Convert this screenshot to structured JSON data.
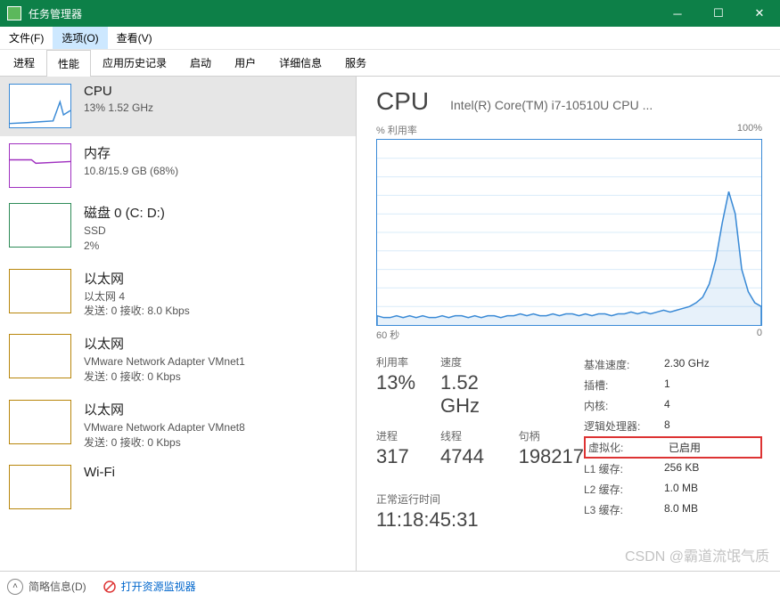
{
  "window": {
    "title": "任务管理器"
  },
  "menu": {
    "file": "文件(F)",
    "options": "选项(O)",
    "view": "查看(V)"
  },
  "tabs": [
    "进程",
    "性能",
    "应用历史记录",
    "启动",
    "用户",
    "详细信息",
    "服务"
  ],
  "active_tab": 1,
  "sidebar": {
    "items": [
      {
        "title": "CPU",
        "line1": "13%  1.52 GHz",
        "color": "blue"
      },
      {
        "title": "内存",
        "line1": "10.8/15.9 GB (68%)",
        "color": "purple"
      },
      {
        "title": "磁盘 0 (C: D:)",
        "line1": "SSD",
        "line2": "2%",
        "color": "green"
      },
      {
        "title": "以太网",
        "line1": "以太网 4",
        "line2": "发送: 0 接收: 8.0 Kbps",
        "color": "brown"
      },
      {
        "title": "以太网",
        "line1": "VMware Network Adapter VMnet1",
        "line2": "发送: 0 接收: 0 Kbps",
        "color": "brown"
      },
      {
        "title": "以太网",
        "line1": "VMware Network Adapter VMnet8",
        "line2": "发送: 0 接收: 0 Kbps",
        "color": "brown"
      },
      {
        "title": "Wi-Fi",
        "line1": "",
        "color": "brown"
      }
    ]
  },
  "detail": {
    "heading": "CPU",
    "model": "Intel(R) Core(TM) i7-10510U CPU ...",
    "chart_top_left": "% 利用率",
    "chart_top_right": "100%",
    "chart_bot_left": "60 秒",
    "chart_bot_right": "0",
    "stats": {
      "util_lbl": "利用率",
      "util_val": "13%",
      "speed_lbl": "速度",
      "speed_val": "1.52 GHz",
      "proc_lbl": "进程",
      "proc_val": "317",
      "thr_lbl": "线程",
      "thr_val": "4744",
      "hnd_lbl": "句柄",
      "hnd_val": "198217",
      "uptime_lbl": "正常运行时间",
      "uptime_val": "11:18:45:31"
    },
    "right": [
      {
        "k": "基准速度:",
        "v": "2.30 GHz"
      },
      {
        "k": "插槽:",
        "v": "1"
      },
      {
        "k": "内核:",
        "v": "4"
      },
      {
        "k": "逻辑处理器:",
        "v": "8"
      },
      {
        "k": "虚拟化:",
        "v": "已启用",
        "boxed": true
      },
      {
        "k": "L1 缓存:",
        "v": "256 KB"
      },
      {
        "k": "L2 缓存:",
        "v": "1.0 MB"
      },
      {
        "k": "L3 缓存:",
        "v": "8.0 MB"
      }
    ]
  },
  "footer": {
    "fewer": "简略信息(D)",
    "resmon": "打开资源监视器"
  },
  "watermark": "CSDN @霸道流氓气质",
  "chart_data": {
    "type": "line",
    "title": "% 利用率",
    "xlabel": "60 秒",
    "ylabel": "% 利用率",
    "ylim": [
      0,
      100
    ],
    "xlim_seconds": [
      60,
      0
    ],
    "series": [
      {
        "name": "CPU 利用率",
        "values": [
          5,
          4,
          4,
          5,
          4,
          5,
          4,
          5,
          4,
          4,
          5,
          4,
          5,
          5,
          4,
          5,
          4,
          5,
          5,
          4,
          5,
          5,
          6,
          5,
          6,
          5,
          5,
          6,
          5,
          6,
          6,
          5,
          6,
          5,
          6,
          6,
          5,
          6,
          6,
          7,
          6,
          7,
          6,
          7,
          8,
          7,
          8,
          9,
          10,
          12,
          15,
          22,
          35,
          55,
          72,
          60,
          30,
          18,
          12,
          10
        ]
      }
    ]
  }
}
